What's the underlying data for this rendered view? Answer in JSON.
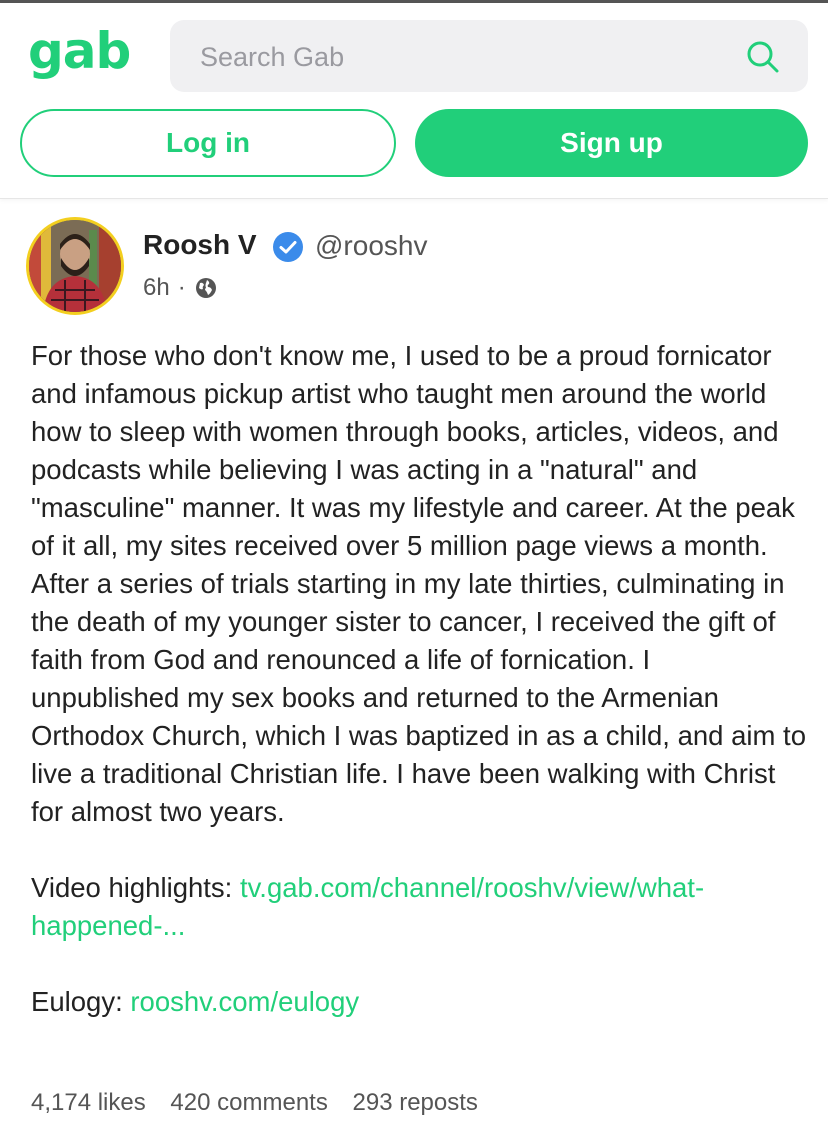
{
  "header": {
    "logo": "gab",
    "search_placeholder": "Search Gab",
    "login_label": "Log in",
    "signup_label": "Sign up"
  },
  "post": {
    "author_name": "Roosh V",
    "handle": "@rooshv",
    "time": "6h",
    "separator": "·",
    "body": "For those who don't know me, I used to be a proud fornicator and infamous pickup artist who taught men around the world how to sleep with women through books, articles, videos, and podcasts while believing I was acting in a \"natural\" and \"masculine\" manner. It was my lifestyle and career. At the peak of it all, my sites received over 5 million page views a month. After a series of trials starting in my late thirties, culminating in the death of my younger sister to cancer, I received the gift of faith from God and renounced a life of fornication. I unpublished my sex books and returned to the Armenian Orthodox Church, which I was baptized in as a child, and aim to live a traditional Christian life. I have been walking with Christ for almost two years.",
    "video_label": "Video highlights: ",
    "video_link": "tv.gab.com/channel/rooshv/view/what-happened-...",
    "eulogy_label": "Eulogy: ",
    "eulogy_link": "rooshv.com/eulogy",
    "likes": "4,174 likes",
    "comments": "420 comments",
    "reposts": "293 reposts"
  },
  "colors": {
    "accent": "#21cf7a",
    "verified": "#3b8bea",
    "avatar_ring": "#f3cf1f"
  },
  "icons": [
    "search-icon",
    "verified-badge-icon",
    "globe-icon"
  ]
}
